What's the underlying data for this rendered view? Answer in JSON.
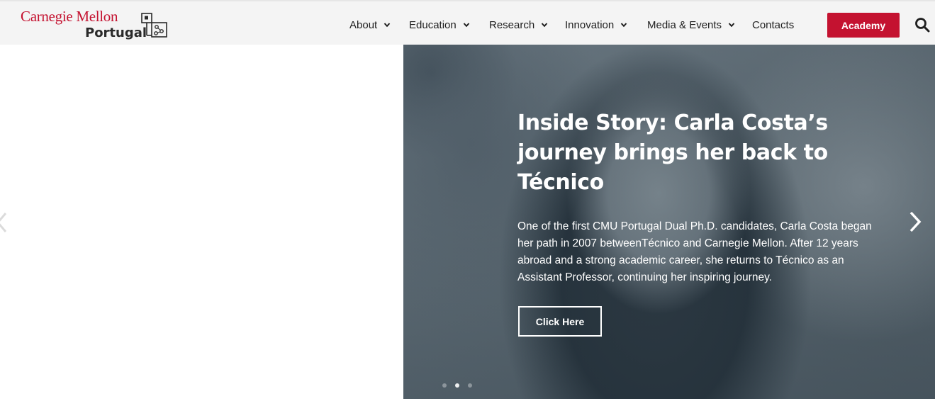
{
  "brand": {
    "line1": "Carnegie Mellon",
    "line2": "Portugal",
    "color": "#c41230"
  },
  "nav": {
    "items": [
      {
        "label": "About",
        "has_dropdown": true
      },
      {
        "label": "Education",
        "has_dropdown": true
      },
      {
        "label": "Research",
        "has_dropdown": true
      },
      {
        "label": "Innovation",
        "has_dropdown": true
      },
      {
        "label": "Media & Events",
        "has_dropdown": true
      },
      {
        "label": "Contacts",
        "has_dropdown": false
      }
    ],
    "academy_label": "Academy",
    "search_icon": "search-icon"
  },
  "hero": {
    "title": "Inside Story: Carla Costa’s journey brings her back to Técnico",
    "text": "One of the first CMU Portugal Dual Ph.D. candidates, Carla Costa began her path in 2007 betweenTécnico and Carnegie Mellon. After 12 years abroad and a strong academic career, she returns to Técnico as an Assistant Professor, continuing her inspiring journey.",
    "cta_label": "Click Here",
    "slides_total": 3,
    "active_slide": 2
  }
}
